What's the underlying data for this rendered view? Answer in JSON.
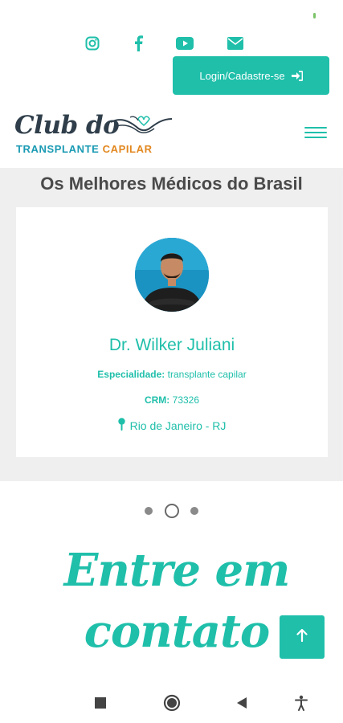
{
  "header": {
    "social_icons": [
      "instagram-icon",
      "facebook-icon",
      "youtube-icon",
      "email-icon"
    ],
    "login_label": "Login/Cadastre-se",
    "login_icon": "sign-in-icon"
  },
  "logo": {
    "line1": "Club do",
    "line2_part1": "TRANSPLANTE ",
    "line2_part2": "CAPILAR"
  },
  "doctors_section": {
    "title": "Os Melhores Médicos do Brasil",
    "doctor": {
      "name": "Dr. Wilker Juliani",
      "specialty_label": "Especialidade:",
      "specialty_value": "transplante capilar",
      "crm_label": "CRM:",
      "crm_value": "73326",
      "location": "Rio de Janeiro - RJ"
    },
    "carousel": {
      "total": 3,
      "active_index": 1
    }
  },
  "contact": {
    "heading_line1": "Entre em",
    "heading_line2": "contato"
  },
  "colors": {
    "accent": "#1fbfaa",
    "logo_dark": "#2f3e4a",
    "logo_blue": "#1a9ab3",
    "logo_orange": "#e2871f",
    "section_bg": "#efefef"
  },
  "system_nav": [
    "stop-square-icon",
    "home-circle-icon",
    "back-triangle-icon",
    "accessibility-icon"
  ]
}
